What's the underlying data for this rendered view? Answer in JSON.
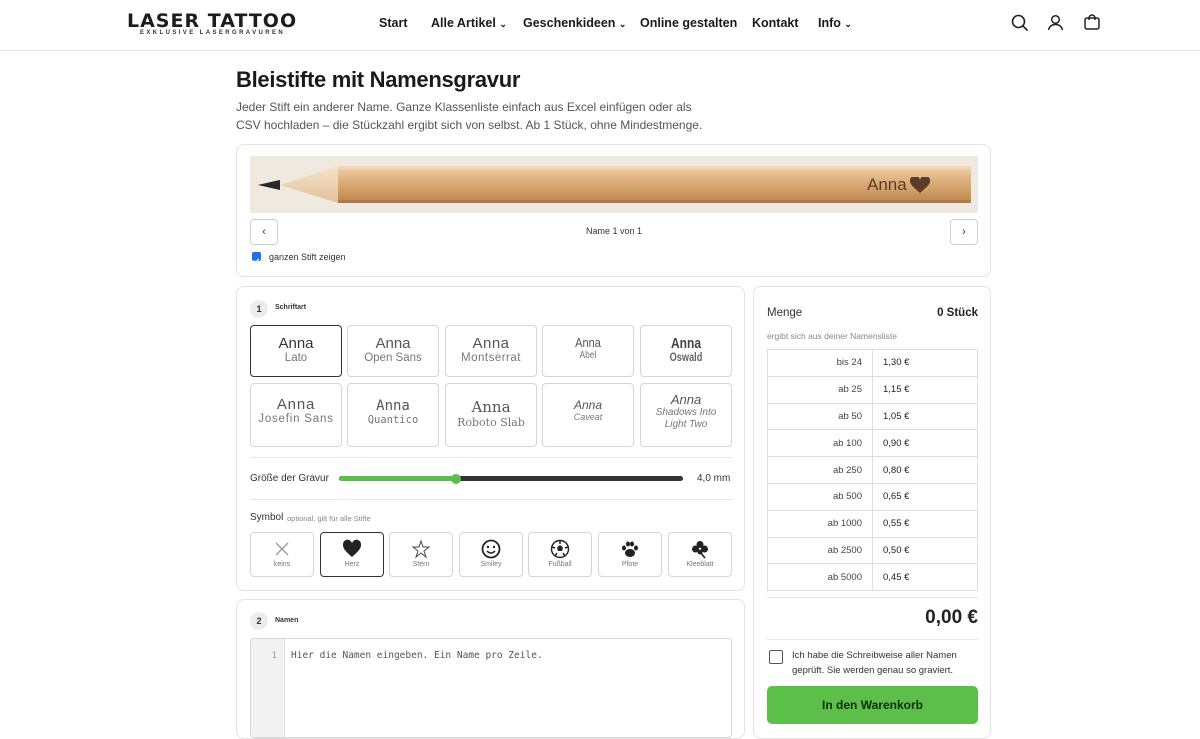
{
  "header": {
    "logo_top": "LASER TATTOO",
    "logo_bottom": "EXKLUSIVE LASERGRAVUREN",
    "nav": [
      "Start",
      "Alle Artikel",
      "Geschenkideen",
      "Online gestalten",
      "Kontakt",
      "Info"
    ]
  },
  "page": {
    "title": "Bleistifte mit Namensgravur",
    "subtitle": "Jeder Stift ein anderer Name. Ganze Klassenliste einfach aus Excel einfügen oder als CSV hochladen – die Stückzahl ergibt sich von selbst. Ab 1 Stück, ohne Mindestmenge."
  },
  "preview": {
    "engraving_text": "Anna",
    "counter": "Name 1 von 1",
    "prev": "‹",
    "next": "›",
    "show_whole_label": "ganzen Stift zeigen",
    "show_whole_checked": true
  },
  "font_step": {
    "number": "1",
    "label": "Schriftart",
    "sample": "Anna",
    "fonts": [
      "Lato",
      "Open Sans",
      "Montserrat",
      "Abel",
      "Oswald",
      "Josefin Sans",
      "Quantico",
      "Roboto Slab",
      "Caveat",
      "Shadows Into Light Two"
    ],
    "selected": "Lato"
  },
  "size": {
    "label": "Größe der Gravur",
    "value": "4,0 mm",
    "fraction": 0.34
  },
  "symbol": {
    "label": "Symbol",
    "hint": "optional, gilt für alle Stifte",
    "options": [
      "keins",
      "Herz",
      "Stern",
      "Smiley",
      "Fußball",
      "Pfote",
      "Kleeblatt"
    ],
    "selected": "Herz"
  },
  "names_step": {
    "number": "2",
    "label": "Namen",
    "line_number": "1",
    "placeholder": "Hier die Namen eingeben. Ein Name pro Zeile."
  },
  "order": {
    "quantity_label": "Menge",
    "quantity_value": "0 Stück",
    "quantity_hint": "ergibt sich aus deiner Namensliste",
    "tiers": [
      {
        "qty": "bis 24",
        "price": "1,30 €"
      },
      {
        "qty": "ab 25",
        "price": "1,15 €"
      },
      {
        "qty": "ab 50",
        "price": "1,05 €"
      },
      {
        "qty": "ab 100",
        "price": "0,90 €"
      },
      {
        "qty": "ab 250",
        "price": "0,80 €"
      },
      {
        "qty": "ab 500",
        "price": "0,65 €"
      },
      {
        "qty": "ab 1000",
        "price": "0,55 €"
      },
      {
        "qty": "ab 2500",
        "price": "0,50 €"
      },
      {
        "qty": "ab 5000",
        "price": "0,45 €"
      }
    ],
    "total": "0,00 €",
    "confirm_label": "Ich habe die Schreibweise aller Namen geprüft. Sie werden genau so graviert.",
    "cart_button": "In den Warenkorb"
  },
  "colors": {
    "accent": "#5cbf49",
    "wood": "#d8a975",
    "text": "#1a1a1a"
  }
}
